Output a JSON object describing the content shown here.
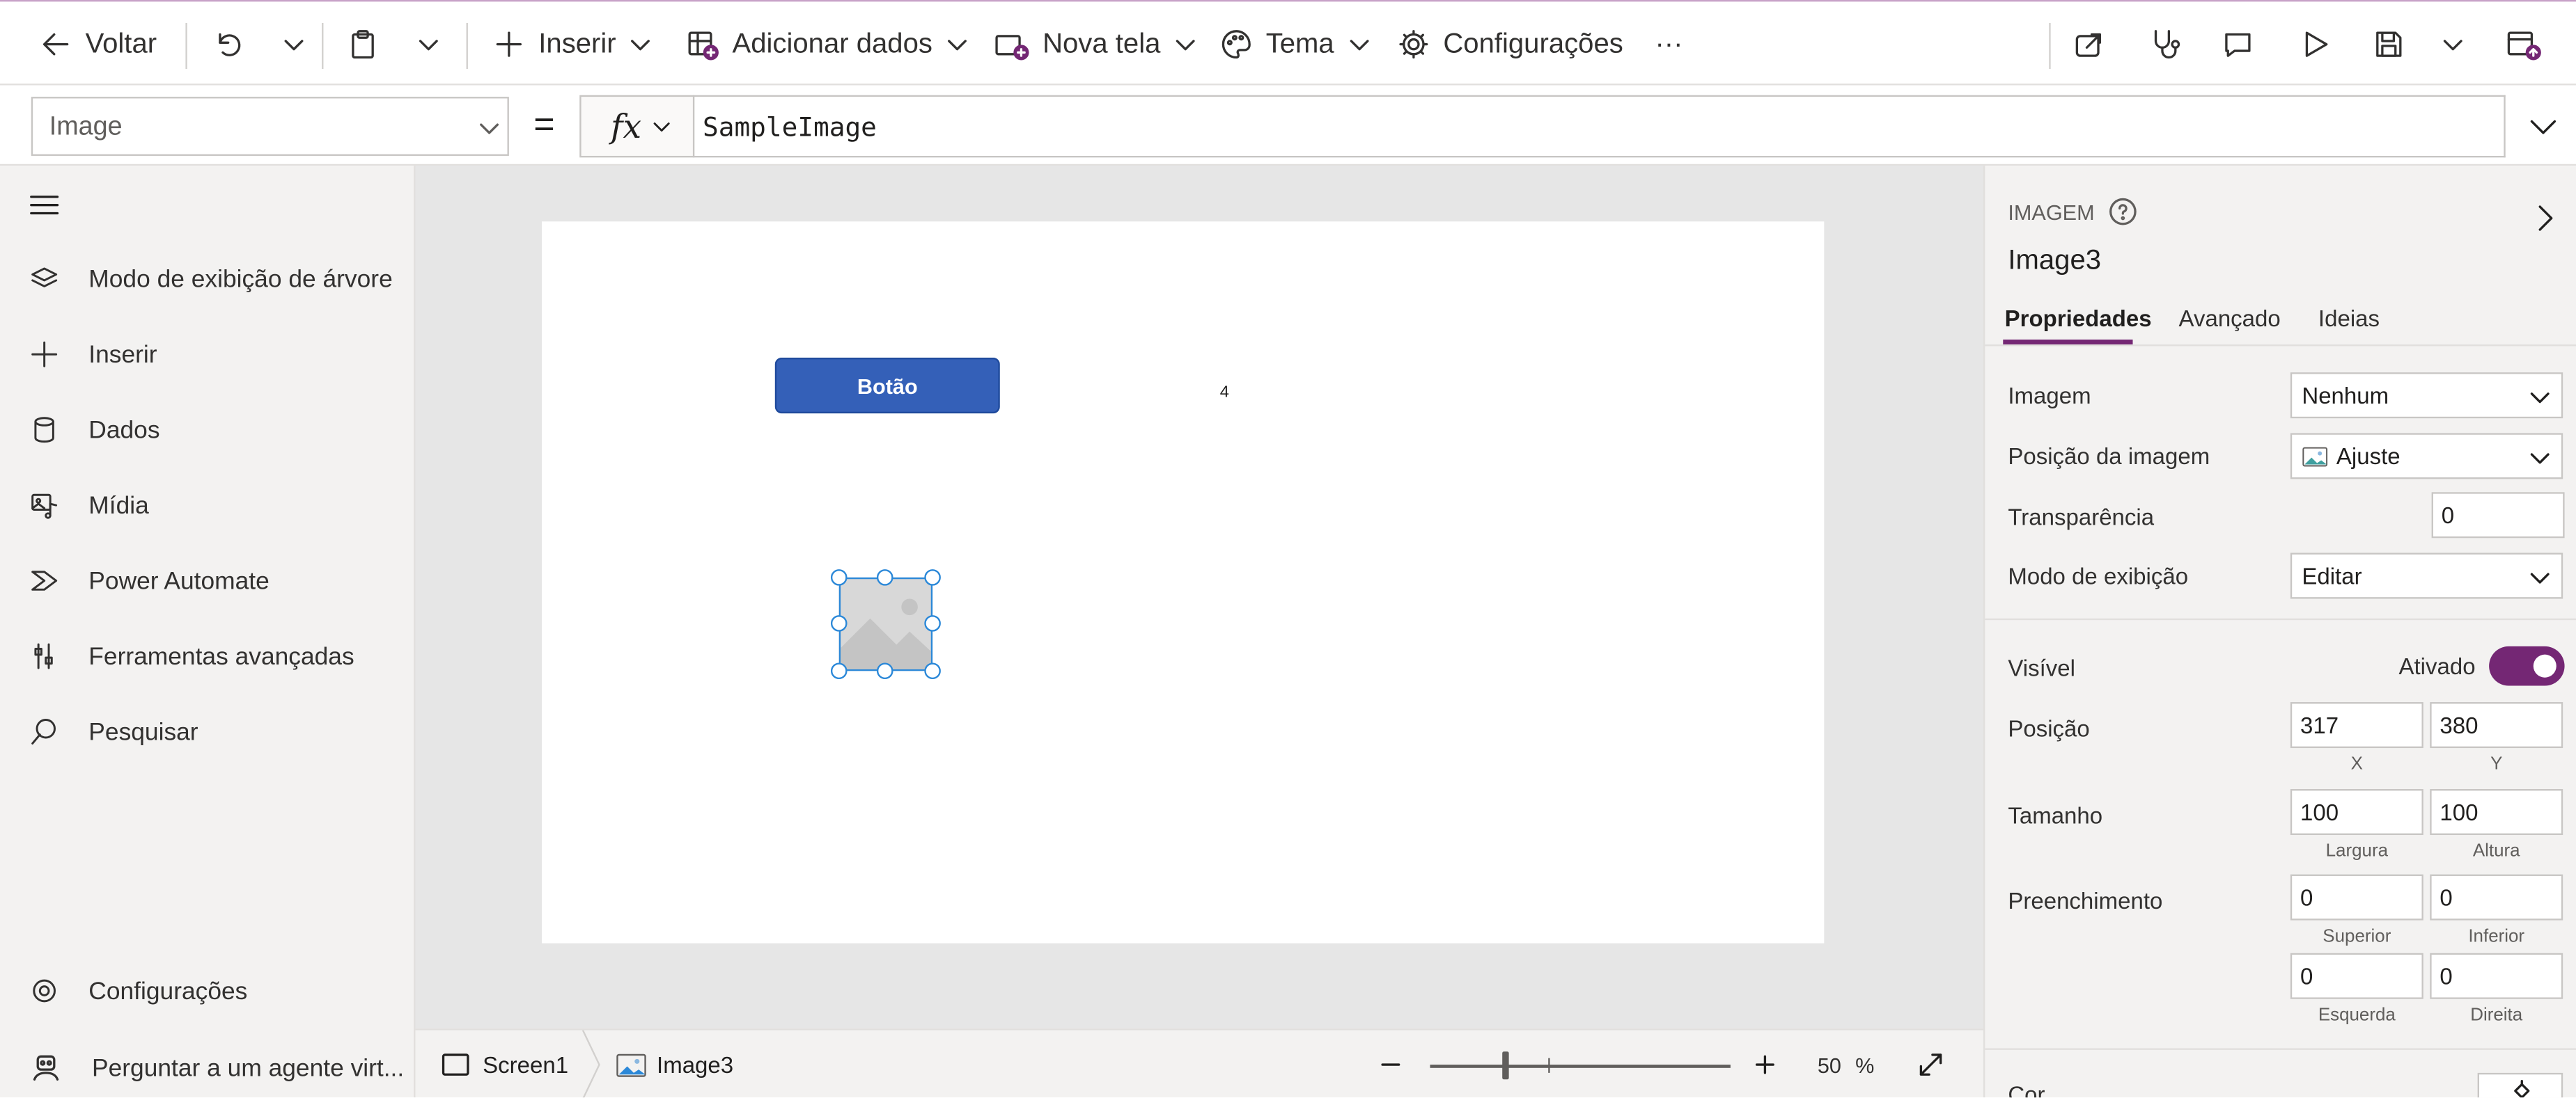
{
  "toolbar": {
    "back": "Voltar",
    "insert": "Inserir",
    "add_data": "Adicionar dados",
    "new_screen": "Nova tela",
    "theme": "Tema",
    "settings": "Configurações",
    "more": "···"
  },
  "formula_bar": {
    "property": "Image",
    "equals": "=",
    "fx": "fx",
    "formula": "SampleImage"
  },
  "left_nav": {
    "items": [
      {
        "label": "Modo de exibição de árvore",
        "icon": "layers-icon"
      },
      {
        "label": "Inserir",
        "icon": "plus-icon"
      },
      {
        "label": "Dados",
        "icon": "database-icon"
      },
      {
        "label": "Mídia",
        "icon": "media-icon"
      },
      {
        "label": "Power Automate",
        "icon": "power-automate-icon"
      },
      {
        "label": "Ferramentas avançadas",
        "icon": "tools-icon"
      },
      {
        "label": "Pesquisar",
        "icon": "search-icon"
      }
    ],
    "settings": "Configurações",
    "virtual_agent": "Perguntar a um agente virt..."
  },
  "canvas": {
    "button_text": "Botão",
    "label_text": "4"
  },
  "bottom_bar": {
    "screen": "Screen1",
    "control": "Image3",
    "zoom": "50",
    "zoom_unit": "%"
  },
  "right_panel": {
    "type": "IMAGEM",
    "name": "Image3",
    "tabs": [
      "Propriedades",
      "Avançado",
      "Ideias"
    ],
    "image_label": "Imagem",
    "image_value": "Nenhum",
    "image_position_label": "Posição da imagem",
    "image_position_value": "Ajuste",
    "transparency_label": "Transparência",
    "transparency_value": "0",
    "display_mode_label": "Modo de exibição",
    "display_mode_value": "Editar",
    "visible_label": "Visível",
    "visible_value": "Ativado",
    "position_label": "Posição",
    "position_x": "317",
    "position_y": "380",
    "x_label": "X",
    "y_label": "Y",
    "size_label": "Tamanho",
    "width_value": "100",
    "height_value": "100",
    "width_label": "Largura",
    "height_label": "Altura",
    "padding_label": "Preenchimento",
    "padding_top": "0",
    "padding_bottom": "0",
    "padding_left": "0",
    "padding_right": "0",
    "top_label": "Superior",
    "bottom_label": "Inferior",
    "left_label": "Esquerda",
    "right_label": "Direita",
    "color_label": "Cor"
  },
  "colors": {
    "accent": "#742774",
    "button": "#3460b8",
    "selection": "#2b88d8"
  }
}
